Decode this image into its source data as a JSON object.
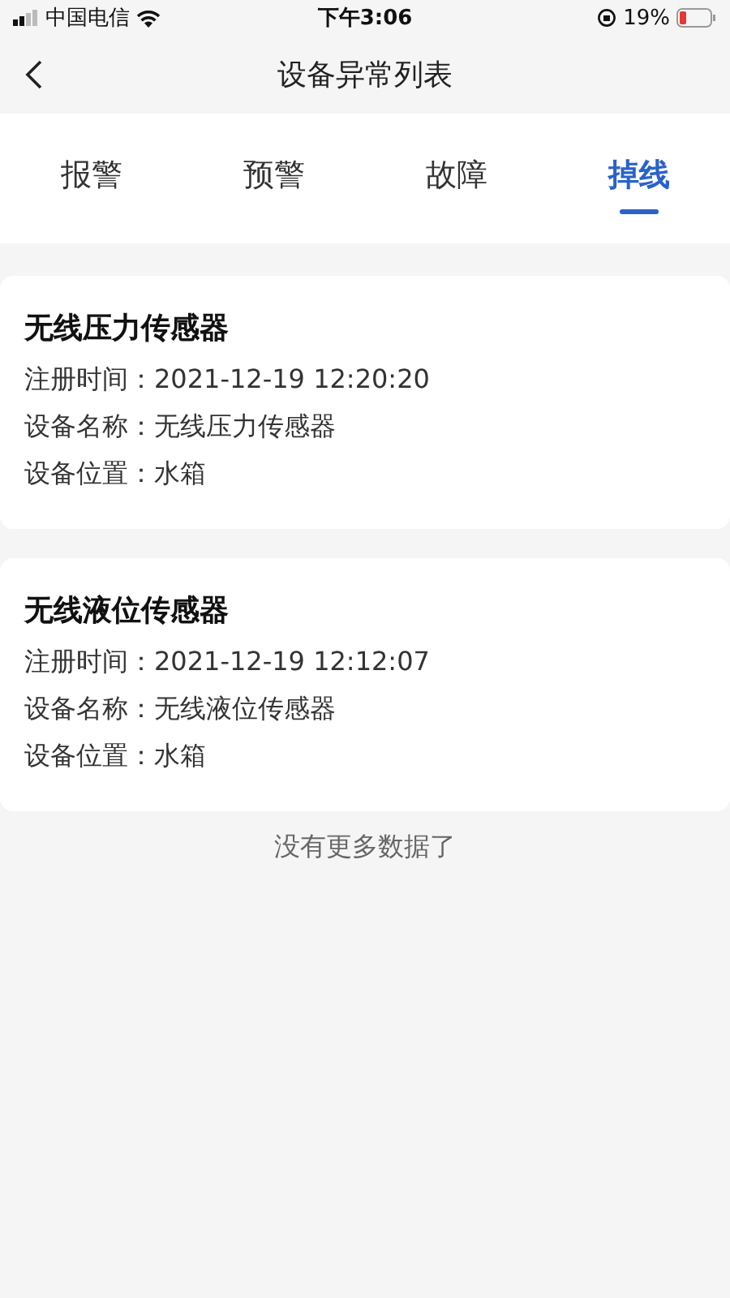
{
  "status_bar": {
    "carrier": "中国电信",
    "time": "下午3:06",
    "battery": "19%"
  },
  "nav": {
    "title": "设备异常列表"
  },
  "tabs": [
    {
      "label": "报警",
      "selected": false
    },
    {
      "label": "预警",
      "selected": false
    },
    {
      "label": "故障",
      "selected": false
    },
    {
      "label": "掉线",
      "selected": true
    }
  ],
  "cards": [
    {
      "title": "无线压力传感器",
      "fields": [
        {
          "label": "注册时间：",
          "value": "2021-12-19 12:20:20"
        },
        {
          "label": "设备名称：",
          "value": "无线压力传感器"
        },
        {
          "label": "设备位置：",
          "value": "水箱"
        }
      ]
    },
    {
      "title": "无线液位传感器",
      "fields": [
        {
          "label": "注册时间：",
          "value": "2021-12-19 12:12:07"
        },
        {
          "label": "设备名称：",
          "value": "无线液位传感器"
        },
        {
          "label": "设备位置：",
          "value": "水箱"
        }
      ]
    }
  ],
  "footer": "没有更多数据了"
}
